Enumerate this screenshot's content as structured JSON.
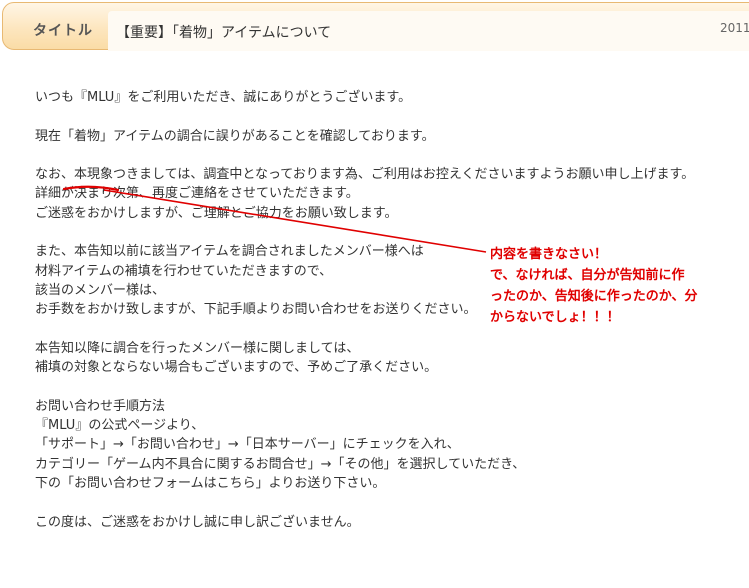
{
  "header": {
    "title_label": "タイトル",
    "title": "【重要】「着物」アイテムについて",
    "date": "2011"
  },
  "body": {
    "paragraphs": [
      [
        "いつも『MLU』をご利用いただき、誠にありがとうございます。"
      ],
      [
        "現在「着物」アイテムの調合に誤りがあることを確認しております。"
      ],
      [
        "なお、本現象つきましては、調査中となっております為、ご利用はお控えくださいますようお願い申し上げます。",
        "詳細が決まり次第、再度ご連絡をさせていただきます。",
        "ご迷惑をおかけしますが、ご理解とご協力をお願い致します。"
      ],
      [
        "また、本告知以前に該当アイテムを調合されましたメンバー様へは",
        "材料アイテムの補填を行わせていただきますので、",
        "該当のメンバー様は、",
        "お手数をおかけ致しますが、下記手順よりお問い合わせをお送りください。"
      ],
      [
        "本告知以降に調合を行ったメンバー様に関しましては、",
        "補填の対象とならない場合もございますので、予めご了承ください。"
      ],
      [
        "お問い合わせ手順方法",
        "『MLU』の公式ページより、",
        "「サポート」→「お問い合わせ」→「日本サーバー」にチェックを入れ、",
        "カテゴリー「ゲーム内不具合に関するお問合せ」→「その他」を選択していただき、",
        "下の「お問い合わせフォームはこちら」よりお送り下さい。"
      ],
      [
        "この度は、ご迷惑をおかけし誠に申し訳ございません。"
      ]
    ]
  },
  "annotation": {
    "lines": [
      "内容を書きなさい！",
      "で、なければ、自分が告知前に作",
      "ったのか、告知後に作ったのか、分",
      "からないでしょ！！！"
    ],
    "color": "#e00000"
  }
}
